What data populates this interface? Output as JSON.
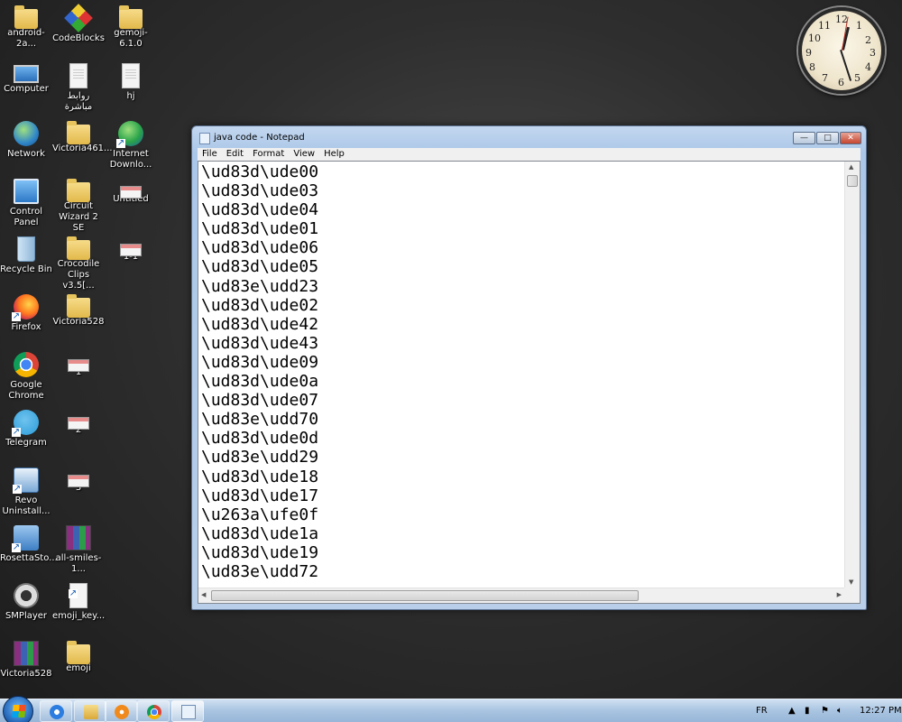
{
  "desktop": {
    "icons": [
      {
        "label": "android-2a...",
        "icon": "folder-zip-icon"
      },
      {
        "label": "CodeBlocks",
        "icon": "codeblocks-icon"
      },
      {
        "label": "gemoji-6.1.0",
        "icon": "folder-icon"
      },
      {
        "label": "Computer",
        "icon": "computer-icon"
      },
      {
        "label": "روابط مباشرة",
        "icon": "document-icon"
      },
      {
        "label": "hj",
        "icon": "document-icon"
      },
      {
        "label": "Network",
        "icon": "network-icon"
      },
      {
        "label": "Victoria461...",
        "icon": "folder-icon"
      },
      {
        "label": "Internet Downlo...",
        "icon": "internet-download-manager-icon"
      },
      {
        "label": "Control Panel",
        "icon": "control-panel-icon"
      },
      {
        "label": "Circuit Wizard 2 SE",
        "icon": "folder-icon"
      },
      {
        "label": "Untitled",
        "icon": "image-icon"
      },
      {
        "label": "Recycle Bin",
        "icon": "recycle-bin-icon"
      },
      {
        "label": "Crocodile Clips v3.5[...",
        "icon": "folder-icon"
      },
      {
        "label": "1-1",
        "icon": "image-icon"
      },
      {
        "label": "Firefox",
        "icon": "firefox-icon"
      },
      {
        "label": "Victoria528",
        "icon": "folder-icon"
      },
      {
        "label": "Google Chrome",
        "icon": "chrome-icon"
      },
      {
        "label": "1",
        "icon": "image-icon"
      },
      {
        "label": "Telegram",
        "icon": "telegram-icon"
      },
      {
        "label": "2",
        "icon": "image-icon"
      },
      {
        "label": "Revo Uninstall...",
        "icon": "revo-uninstaller-icon"
      },
      {
        "label": "3",
        "icon": "image-icon"
      },
      {
        "label": "RosettaSto...",
        "icon": "rosetta-stone-icon"
      },
      {
        "label": "all-smiles-1...",
        "icon": "winrar-archive-icon"
      },
      {
        "label": "SMPlayer",
        "icon": "smplayer-icon"
      },
      {
        "label": "emoji_key...",
        "icon": "shortcut-file-icon"
      },
      {
        "label": "Victoria528",
        "icon": "winrar-archive-icon"
      },
      {
        "label": "emoji",
        "icon": "folder-icon"
      }
    ]
  },
  "clock": {
    "numerals": [
      "12",
      "1",
      "2",
      "3",
      "4",
      "5",
      "6",
      "7",
      "8",
      "9",
      "10",
      "11"
    ],
    "time_hours": 12,
    "time_minutes": 27
  },
  "notepad": {
    "title": "java code - Notepad",
    "menu": [
      "File",
      "Edit",
      "Format",
      "View",
      "Help"
    ],
    "lines": [
      "\\ud83d\\ude00",
      "\\ud83d\\ude03",
      "\\ud83d\\ude04",
      "\\ud83d\\ude01",
      "\\ud83d\\ude06",
      "\\ud83d\\ude05",
      "\\ud83e\\udd23",
      "\\ud83d\\ude02",
      "\\ud83d\\ude42",
      "\\ud83d\\ude43",
      "\\ud83d\\ude09",
      "\\ud83d\\ude0a",
      "\\ud83d\\ude07",
      "\\ud83e\\udd70",
      "\\ud83d\\ude0d",
      "\\ud83e\\udd29",
      "\\ud83d\\ude18",
      "\\ud83d\\ude17",
      "\\u263a\\ufe0f",
      "\\ud83d\\ude1a",
      "\\ud83d\\ude19",
      "\\ud83e\\udd72"
    ],
    "buttons": {
      "minimize": "—",
      "maximize": "□",
      "close": "✕"
    }
  },
  "taskbar": {
    "pinned": [
      "internet-explorer-icon",
      "windows-explorer-icon",
      "media-player-icon",
      "chrome-icon",
      "notepad-icon"
    ],
    "language": "FR",
    "time": "12:27 PM"
  }
}
